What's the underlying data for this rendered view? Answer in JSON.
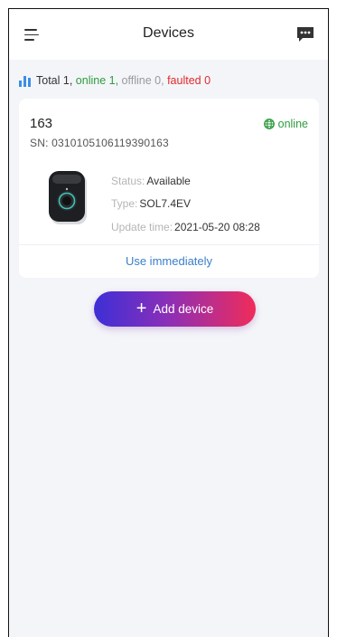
{
  "header": {
    "title": "Devices"
  },
  "summary": {
    "total_label": "Total 1,",
    "online_label": "online 1,",
    "offline_label": "offline 0,",
    "faulted_label": "faulted 0"
  },
  "device": {
    "name": "163",
    "sn_label": "SN:",
    "sn": "0310105106119390163",
    "connection_status": "online",
    "status_key": "Status:",
    "status_value": "Available",
    "type_key": "Type:",
    "type_value": "SOL7.4EV",
    "update_key": "Update time:",
    "update_value": "2021-05-20 08:28",
    "action_label": "Use immediately"
  },
  "actions": {
    "add_device_label": "Add device",
    "add_device_icon": "+"
  },
  "colors": {
    "online": "#2e9b3f",
    "offline": "#9a9a9a",
    "faulted": "#e02b2b",
    "link": "#3a7fc8",
    "gradient_start": "#3d2fd6",
    "gradient_end": "#f02c5a"
  }
}
